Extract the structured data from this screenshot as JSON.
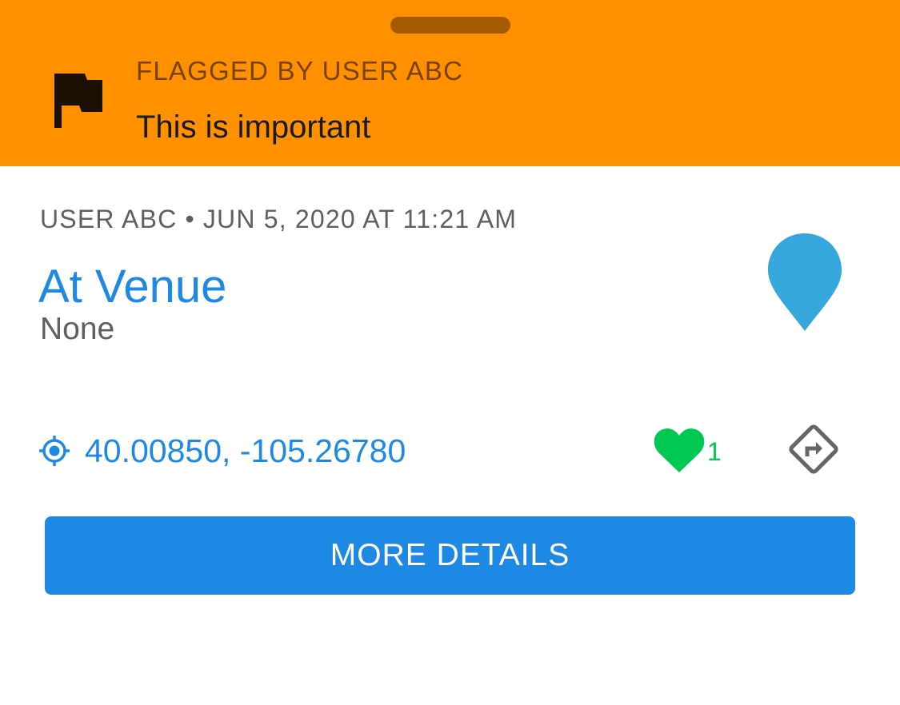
{
  "banner": {
    "header": "FLAGGED BY USER ABC",
    "message": "This is important",
    "background_color": "#FF9100",
    "icon": "flag-icon"
  },
  "observation": {
    "user": "USER ABC",
    "separator": "•",
    "timestamp": "JUN 5, 2020 AT 11:21 AM",
    "title": "At Venue",
    "subtitle": "None",
    "title_color": "#1E88E5",
    "marker_icon": "map-pin-icon",
    "marker_color": "#35A7DD"
  },
  "location": {
    "icon": "gps-target-icon",
    "coordinates": "40.00850, -105.26780"
  },
  "favorites": {
    "icon": "heart-icon",
    "count": "1",
    "color": "#00C853"
  },
  "directions": {
    "icon": "directions-icon"
  },
  "actions": {
    "more_details_label": "MORE DETAILS",
    "button_color": "#1E88E5"
  }
}
